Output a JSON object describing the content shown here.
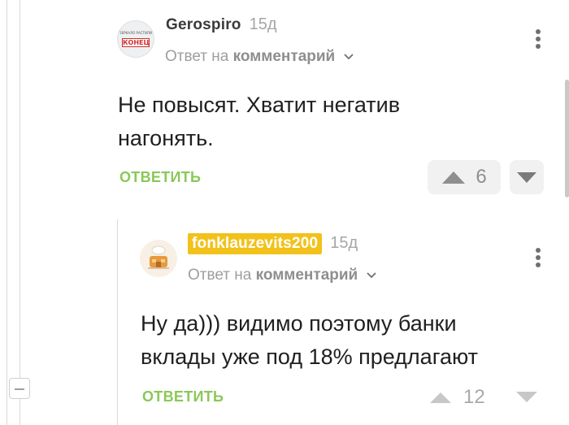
{
  "comments": [
    {
      "author": "Gerospiro",
      "time": "15д",
      "avatar_text_top": "ЗЕРКАЛО РАСТИЛИ",
      "avatar_text_main": "КОНЕЦ",
      "reply_prefix": "Ответ на",
      "reply_link": "комментарий",
      "body_line1": "Не повысят. Хватит негатив",
      "body_line2": "нагонять.",
      "reply_label": "ОТВЕТИТЬ",
      "rating": "6"
    },
    {
      "author": "fonklauzevits200",
      "time": "15д",
      "reply_prefix": "Ответ на",
      "reply_link": "комментарий",
      "body_line1": "Ну да))) видимо поэтому банки",
      "body_line2": "вклады уже под 18% предлагают",
      "reply_label": "ОТВЕТИТЬ",
      "rating": "12"
    }
  ],
  "icons": {
    "upvote": "triangle-up",
    "downvote": "triangle-down",
    "menu": "kebab-vertical",
    "collapse": "minus-box"
  },
  "colors": {
    "reply_green": "#8ac858",
    "author_highlight": "#f2c21b",
    "vote_bg": "#f1f1f1"
  }
}
